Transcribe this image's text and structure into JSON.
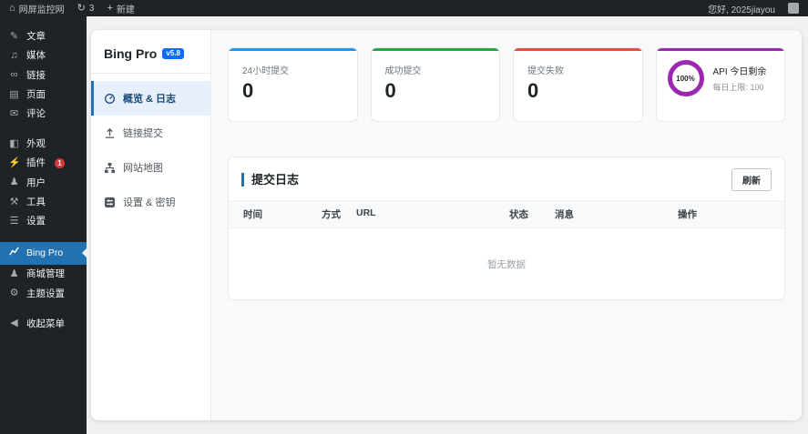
{
  "admin_bar": {
    "site_name": "网屏监控网",
    "updates_count": "3",
    "new_label": "新建",
    "greeting": "您好, 2025jiayou"
  },
  "sidebar": {
    "items": [
      {
        "label": "文章",
        "icon": "pin-icon"
      },
      {
        "label": "媒体",
        "icon": "media-icon"
      },
      {
        "label": "链接",
        "icon": "link-icon"
      },
      {
        "label": "页面",
        "icon": "pages-icon"
      },
      {
        "label": "评论",
        "icon": "comments-icon"
      },
      {
        "label": "外观",
        "icon": "appearance-icon"
      },
      {
        "label": "插件",
        "icon": "plugin-icon",
        "badge": "1"
      },
      {
        "label": "用户",
        "icon": "users-icon"
      },
      {
        "label": "工具",
        "icon": "tools-icon"
      },
      {
        "label": "设置",
        "icon": "settings-icon"
      },
      {
        "label": "Bing Pro",
        "icon": "chart-line-icon",
        "active": true
      },
      {
        "label": "商城管理",
        "icon": "store-icon"
      },
      {
        "label": "主题设置",
        "icon": "gear-icon"
      },
      {
        "label": "收起菜单",
        "icon": "collapse-icon"
      }
    ]
  },
  "plugin_panel": {
    "title": "Bing Pro",
    "version_badge": "v5.8",
    "items": [
      {
        "label": "概览 & 日志",
        "icon": "gauge-icon",
        "active": true
      },
      {
        "label": "链接提交",
        "icon": "upload-icon"
      },
      {
        "label": "网站地图",
        "icon": "sitemap-icon"
      },
      {
        "label": "设置 & 密钥",
        "icon": "settings-keys-icon"
      }
    ]
  },
  "stats": {
    "cards": [
      {
        "label": "24小时提交",
        "value": "0",
        "accent": "#2196f3"
      },
      {
        "label": "成功提交",
        "value": "0",
        "accent": "#28a745"
      },
      {
        "label": "提交失败",
        "value": "0",
        "accent": "#e74c3c"
      },
      {
        "label": "API 今日剩余",
        "sub": "每日上限: 100",
        "ring_text": "100%",
        "accent": "#9c27b0"
      }
    ]
  },
  "log": {
    "title": "提交日志",
    "refresh_label": "刷新",
    "columns": [
      "时间",
      "方式",
      "URL",
      "状态",
      "消息",
      "操作"
    ],
    "empty_text": "暂无数据"
  },
  "colors": {
    "admin_dark": "#1d2327",
    "active_blue": "#2271b1",
    "page_background": "#f0f0f1",
    "badge_red": "#d63638",
    "version_badge_blue": "#0d6efd"
  }
}
